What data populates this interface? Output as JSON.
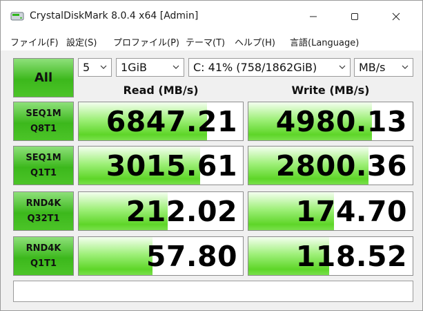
{
  "window": {
    "title": "CrystalDiskMark 8.0.4 x64 [Admin]"
  },
  "menu": {
    "file": "ファイル(F)",
    "settings": "設定(S)",
    "profile": "プロファイル(P)",
    "theme": "テーマ(T)",
    "help": "ヘルプ(H)",
    "language": "言語(Language)"
  },
  "controls": {
    "all_label": "All",
    "count": "5",
    "size": "1GiB",
    "drive": "C: 41% (758/1862GiB)",
    "unit": "MB/s"
  },
  "headers": {
    "read": "Read (MB/s)",
    "write": "Write (MB/s)"
  },
  "tests": [
    {
      "line1": "SEQ1M",
      "line2": "Q8T1",
      "read": "6847.21",
      "write": "4980.13",
      "read_fill": 0.78,
      "write_fill": 0.75
    },
    {
      "line1": "SEQ1M",
      "line2": "Q1T1",
      "read": "3015.61",
      "write": "2800.36",
      "read_fill": 0.74,
      "write_fill": 0.73
    },
    {
      "line1": "RND4K",
      "line2": "Q32T1",
      "read": "212.02",
      "write": "174.70",
      "read_fill": 0.54,
      "write_fill": 0.52
    },
    {
      "line1": "RND4K",
      "line2": "Q1T1",
      "read": "57.80",
      "write": "118.52",
      "read_fill": 0.45,
      "write_fill": 0.49
    }
  ],
  "comment": "",
  "colors": {
    "accent_green": "#3cb81c",
    "bar_green": "#5ed628"
  }
}
